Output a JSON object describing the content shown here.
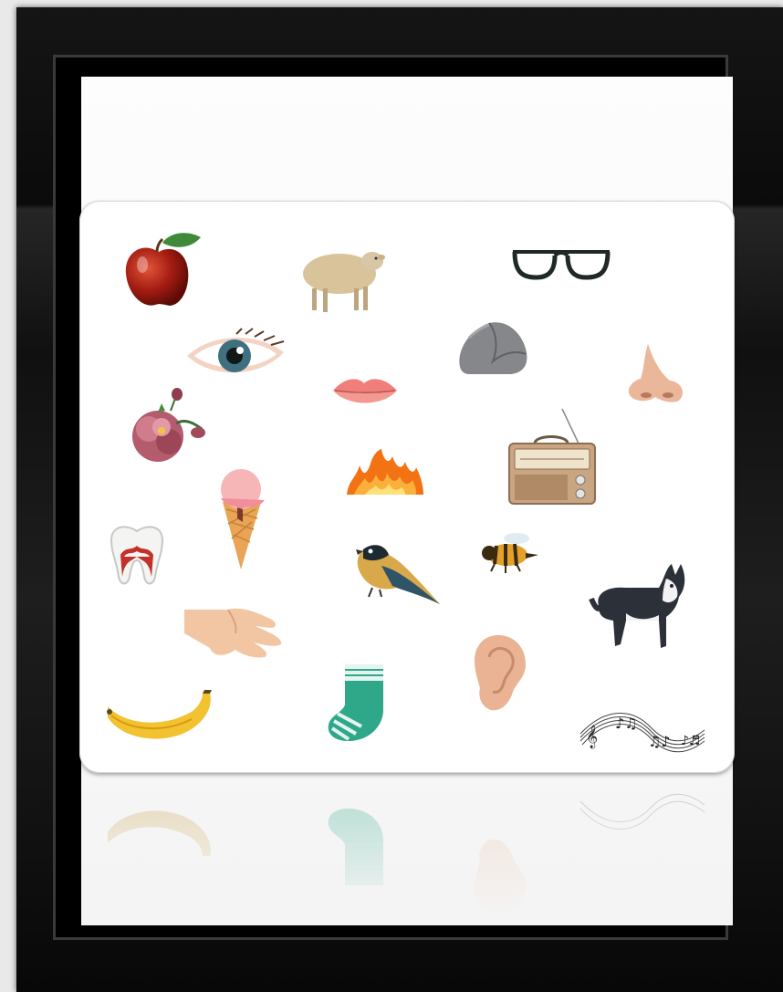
{
  "slide": {
    "items": [
      {
        "name": "apple"
      },
      {
        "name": "sheep"
      },
      {
        "name": "glasses"
      },
      {
        "name": "eye"
      },
      {
        "name": "rock"
      },
      {
        "name": "nose"
      },
      {
        "name": "lips"
      },
      {
        "name": "flower"
      },
      {
        "name": "fire"
      },
      {
        "name": "radio"
      },
      {
        "name": "ice-cream"
      },
      {
        "name": "tooth"
      },
      {
        "name": "bird"
      },
      {
        "name": "bee"
      },
      {
        "name": "dog"
      },
      {
        "name": "hand"
      },
      {
        "name": "ear"
      },
      {
        "name": "banana"
      },
      {
        "name": "sock"
      },
      {
        "name": "music-notes"
      }
    ],
    "colors": {
      "frame": "#0b0b0b",
      "card": "#ffffff",
      "background": "#e9e9e9"
    }
  }
}
